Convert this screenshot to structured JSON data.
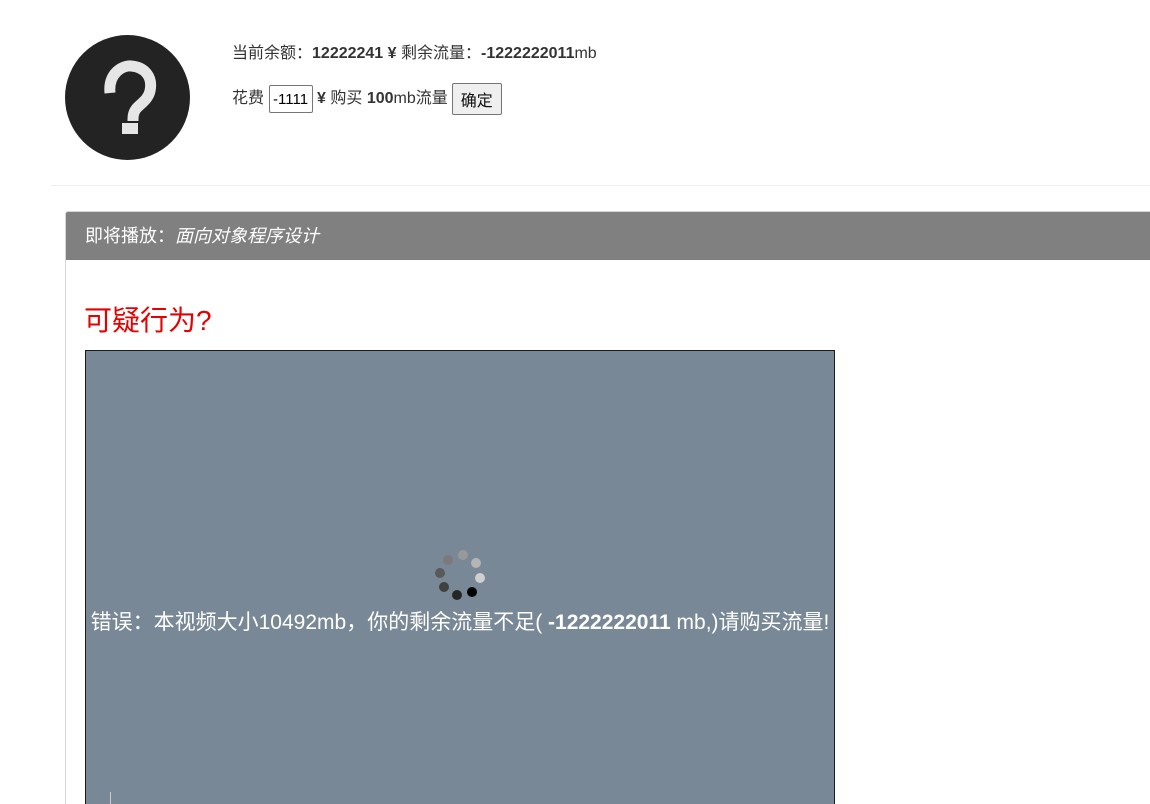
{
  "account": {
    "balance_label": "当前余额：",
    "balance_value": "12222241",
    "currency_symbol": "¥",
    "traffic_label": "剩余流量：",
    "traffic_value": "-1222222011",
    "traffic_unit": "mb"
  },
  "purchase": {
    "spend_label": "花费",
    "amount_value": "-1111",
    "currency_symbol": "¥",
    "buy_label": "购买",
    "buy_amount": "100",
    "buy_unit": "mb流量",
    "confirm_label": "确定"
  },
  "panel": {
    "heading_prefix": "即将播放：",
    "video_title": "面向对象程序设计"
  },
  "alert": {
    "title": "可疑行为?"
  },
  "video": {
    "error_prefix": "错误：本视频大小10492mb，你的剩余流量不足(",
    "error_traffic": "-1222222011",
    "error_suffix": "mb,)请购买流量!"
  },
  "colors": {
    "panel_heading_bg": "#808080",
    "alert_red": "#e60000",
    "video_bg": "#788896",
    "avatar_bg": "#232323"
  },
  "icons": {
    "avatar": "question-mark-avatar-icon",
    "loading": "loading-spinner-icon"
  }
}
